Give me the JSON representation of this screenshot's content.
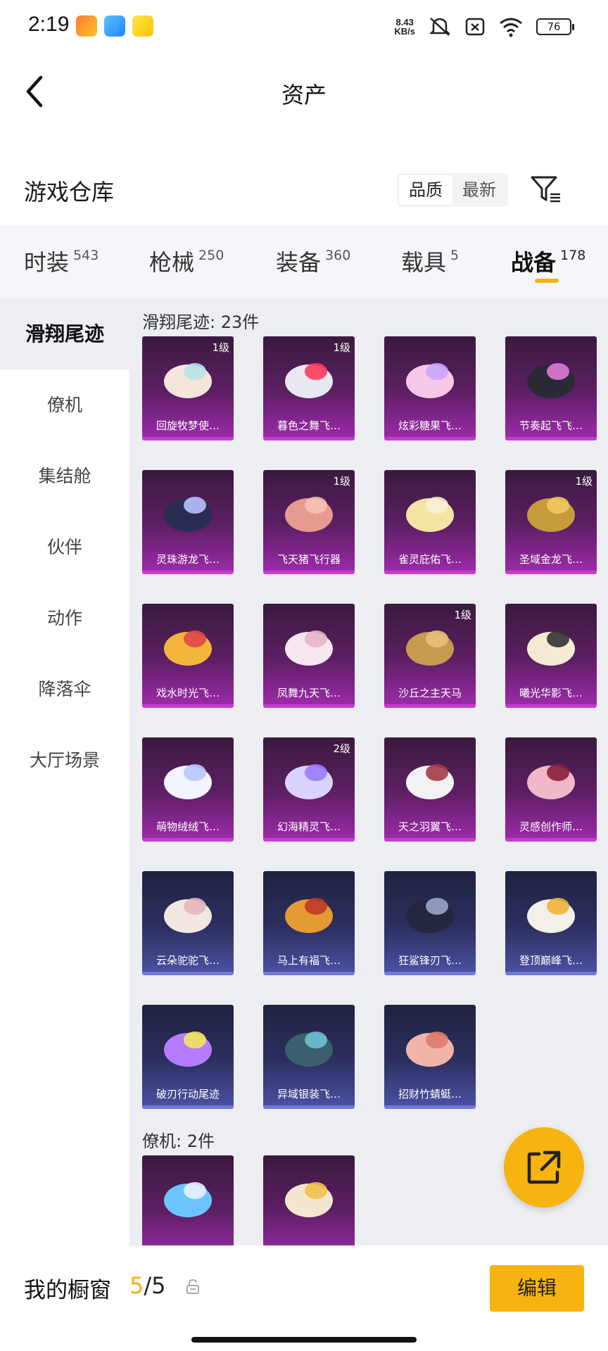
{
  "status_bar": {
    "time": "2:19",
    "net_speed_value": "8.43",
    "net_speed_unit": "KB/s",
    "battery": "76",
    "app_icons": [
      "game-app-icon",
      "message-app-icon",
      "video-app-icon"
    ]
  },
  "header": {
    "title": "资产"
  },
  "warehouse": {
    "title": "游戏仓库",
    "sort_options": [
      "品质",
      "最新"
    ],
    "sort_active": "品质"
  },
  "tabs": [
    {
      "label": "时装",
      "count": "543"
    },
    {
      "label": "枪械",
      "count": "250"
    },
    {
      "label": "装备",
      "count": "360"
    },
    {
      "label": "载具",
      "count": "5"
    },
    {
      "label": "战备",
      "count": "178",
      "active": true
    }
  ],
  "sidebar": [
    {
      "label": "滑翔尾迹",
      "active": true
    },
    {
      "label": "僚机"
    },
    {
      "label": "集结舱"
    },
    {
      "label": "伙伴"
    },
    {
      "label": "动作"
    },
    {
      "label": "降落伞"
    },
    {
      "label": "大厅场景"
    }
  ],
  "groups": [
    {
      "label": "滑翔尾迹: 23件",
      "items": [
        {
          "name": "回旋牧梦使…",
          "level": "1级",
          "rarity": "purple",
          "icon": "dream-carousel-icon"
        },
        {
          "name": "暮色之舞飞…",
          "level": "1级",
          "rarity": "purple",
          "icon": "dusk-dance-icon"
        },
        {
          "name": "炫彩糖果飞…",
          "level": "",
          "rarity": "purple",
          "icon": "candy-glider-icon"
        },
        {
          "name": "节奏起飞飞…",
          "level": "",
          "rarity": "purple",
          "icon": "cat-pod-icon"
        },
        {
          "name": "灵珠游龙飞…",
          "level": "",
          "rarity": "purple",
          "icon": "dragon-glider-icon"
        },
        {
          "name": "飞天猪飞行器",
          "level": "1级",
          "rarity": "purple",
          "icon": "flying-pig-icon"
        },
        {
          "name": "雀灵庇佑飞…",
          "level": "",
          "rarity": "purple",
          "icon": "golden-bird-icon"
        },
        {
          "name": "圣域金龙飞…",
          "level": "1级",
          "rarity": "purple",
          "icon": "golden-dragon-icon"
        },
        {
          "name": "戏水时光飞…",
          "level": "",
          "rarity": "purple",
          "icon": "giraffe-float-icon"
        },
        {
          "name": "凤舞九天飞…",
          "level": "",
          "rarity": "purple",
          "icon": "phoenix-icon"
        },
        {
          "name": "沙丘之主天马",
          "level": "1级",
          "rarity": "purple",
          "icon": "pegasus-icon"
        },
        {
          "name": "曦光华影飞…",
          "level": "",
          "rarity": "purple",
          "icon": "light-flower-icon"
        },
        {
          "name": "萌物绒绒飞…",
          "level": "",
          "rarity": "purple",
          "icon": "bunny-icon"
        },
        {
          "name": "幻海精灵飞…",
          "level": "2级",
          "rarity": "purple",
          "icon": "jellyfish-icon"
        },
        {
          "name": "天之羽翼飞…",
          "level": "",
          "rarity": "purple",
          "icon": "feather-wing-icon"
        },
        {
          "name": "灵感创作师…",
          "level": "",
          "rarity": "purple",
          "icon": "brush-icon"
        },
        {
          "name": "云朵驼驼飞…",
          "level": "",
          "rarity": "blue",
          "icon": "alpaca-icon"
        },
        {
          "name": "马上有福飞…",
          "level": "",
          "rarity": "blue",
          "icon": "lucky-horse-icon"
        },
        {
          "name": "狂鲨锋刃飞…",
          "level": "",
          "rarity": "blue",
          "icon": "shark-icon"
        },
        {
          "name": "登顶巅峰飞…",
          "level": "",
          "rarity": "blue",
          "icon": "jet-glider-icon"
        },
        {
          "name": "破刃行动尾迹",
          "level": "",
          "rarity": "blue",
          "icon": "trail-smoke-icon"
        },
        {
          "name": "异域银装飞…",
          "level": "",
          "rarity": "blue",
          "icon": "silver-wing-icon"
        },
        {
          "name": "招财竹蜻蜓…",
          "level": "",
          "rarity": "blue",
          "icon": "propeller-pig-icon"
        }
      ]
    },
    {
      "label": "僚机: 2件",
      "items": [
        {
          "name": "",
          "level": "",
          "rarity": "purple",
          "icon": "blue-monster-icon"
        },
        {
          "name": "",
          "level": "",
          "rarity": "purple",
          "icon": "baby-dragon-icon"
        }
      ]
    }
  ],
  "showcase": {
    "label": "我的橱窗",
    "current": "5",
    "total": "/5",
    "edit_label": "编辑"
  },
  "colors": {
    "accent": "#f7b30f",
    "purple_card": "#9b2aa8",
    "blue_card": "#4a4fa1"
  }
}
